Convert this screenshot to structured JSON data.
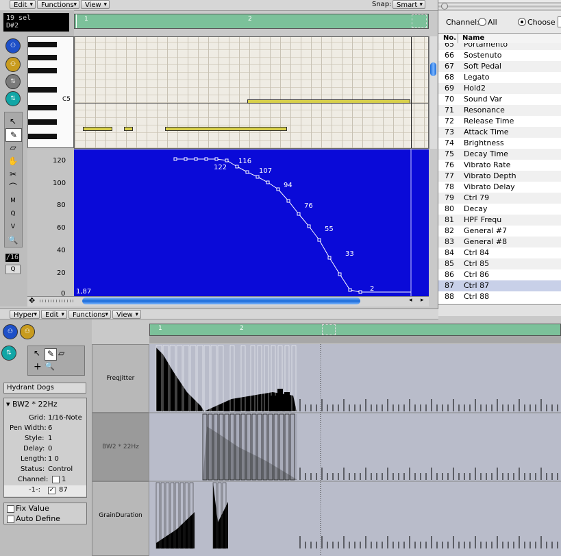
{
  "colors": {
    "accent": "#0a0ad8",
    "ruler": "#7cc19a",
    "note": "#d8d04a"
  },
  "top_menu": {
    "edit": "Edit",
    "functions": "Functions",
    "view": "View",
    "snap_label": "Snap:",
    "snap_value": "Smart"
  },
  "info_display": {
    "line1": "19 sel",
    "line2": "D#2"
  },
  "ruler": {
    "bar1": "1",
    "bar2": "2"
  },
  "piano": {
    "c5_label": "C5"
  },
  "controller_axis": {
    "ticks": [
      "120",
      "100",
      "80",
      "60",
      "40",
      "20",
      "0"
    ]
  },
  "controller_points": {
    "start_label": "1,87",
    "labels": [
      "122",
      "116",
      "107",
      "94",
      "76",
      "55",
      "33",
      "2"
    ]
  },
  "toolbar_display": {
    "quantize": "/16",
    "q": "Q"
  },
  "channel_panel": {
    "channel_label": "Channel:",
    "all": "All",
    "choose": "Choose",
    "col_no": "No.",
    "col_name": "Name",
    "rows": [
      {
        "no": "65",
        "name": "Portamento"
      },
      {
        "no": "66",
        "name": "Sostenuto"
      },
      {
        "no": "67",
        "name": "Soft Pedal"
      },
      {
        "no": "68",
        "name": "Legato"
      },
      {
        "no": "69",
        "name": "Hold2"
      },
      {
        "no": "70",
        "name": "Sound Var"
      },
      {
        "no": "71",
        "name": "Resonance"
      },
      {
        "no": "72",
        "name": "Release Time"
      },
      {
        "no": "73",
        "name": "Attack Time"
      },
      {
        "no": "74",
        "name": "Brightness"
      },
      {
        "no": "75",
        "name": "Decay Time"
      },
      {
        "no": "76",
        "name": "Vibrato Rate"
      },
      {
        "no": "77",
        "name": "Vibrato Depth"
      },
      {
        "no": "78",
        "name": "Vibrato Delay"
      },
      {
        "no": "79",
        "name": "Ctrl 79"
      },
      {
        "no": "80",
        "name": "Decay"
      },
      {
        "no": "81",
        "name": "HPF Frequ"
      },
      {
        "no": "82",
        "name": "General #7"
      },
      {
        "no": "83",
        "name": "General #8"
      },
      {
        "no": "84",
        "name": "Ctrl 84"
      },
      {
        "no": "85",
        "name": "Ctrl 85"
      },
      {
        "no": "86",
        "name": "Ctrl 86"
      },
      {
        "no": "87",
        "name": "Ctrl 87"
      },
      {
        "no": "88",
        "name": "Ctrl 88"
      }
    ]
  },
  "hyper_menu": {
    "hyper": "Hyper",
    "edit": "Edit",
    "functions": "Functions",
    "view": "View"
  },
  "hyper_ruler": {
    "bar1": "1",
    "bar2": "2"
  },
  "hyper_set": "Hydrant Dogs",
  "inspector": {
    "title": "BW2 * 22Hz",
    "grid_label": "Grid:",
    "grid_value": "1/16-Note",
    "pen_label": "Pen Width:",
    "pen_value": "6",
    "style_label": "Style:",
    "style_value": "1",
    "delay_label": "Delay:",
    "delay_value": "0",
    "length_label": "Length:",
    "length_value": "1    0",
    "status_label": "Status:",
    "status_value": "Control",
    "channel_label": "Channel:",
    "channel_value": "1",
    "num_label": "-1-:",
    "num_value": "87"
  },
  "options": {
    "fix_value": "Fix Value",
    "auto_define": "Auto Define"
  },
  "lanes": [
    {
      "name": "FreqJitter"
    },
    {
      "name": "BW2 * 22Hz"
    },
    {
      "name": "GrainDuration"
    }
  ]
}
